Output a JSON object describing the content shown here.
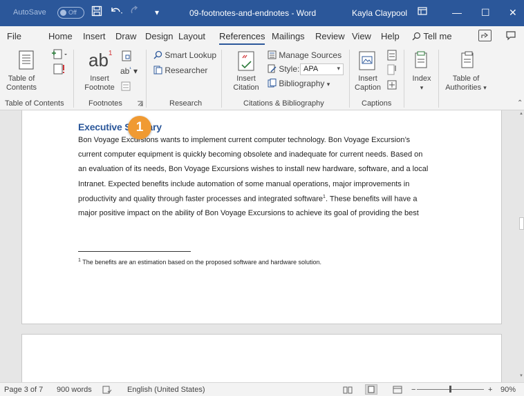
{
  "titlebar": {
    "autosave_label": "AutoSave",
    "autosave_state": "Off",
    "doc_title": "09-footnotes-and-endnotes - Word",
    "user": "Kayla Claypool"
  },
  "tabs": [
    "File",
    "Home",
    "Insert",
    "Draw",
    "Design",
    "Layout",
    "References",
    "Mailings",
    "Review",
    "View",
    "Help"
  ],
  "active_tab": "References",
  "tell_me": "Tell me",
  "ribbon": {
    "toc": {
      "button": "Table of Contents",
      "line1": "Table of",
      "line2": "Contents",
      "group": "Table of Contents"
    },
    "footnotes": {
      "insert_footnote_line1": "Insert",
      "insert_footnote_line2": "Footnote",
      "ab_glyph": "ab",
      "group": "Footnotes"
    },
    "research": {
      "smart_lookup": "Smart Lookup",
      "researcher": "Researcher",
      "group": "Research"
    },
    "citations": {
      "insert_citation_line1": "Insert",
      "insert_citation_line2": "Citation",
      "manage_sources": "Manage Sources",
      "style_label": "Style:",
      "style_value": "APA",
      "bibliography": "Bibliography",
      "group": "Citations & Bibliography"
    },
    "captions": {
      "insert_caption_line1": "Insert",
      "insert_caption_line2": "Caption",
      "group": "Captions"
    },
    "index": {
      "label": "Index"
    },
    "authorities": {
      "line1": "Table of",
      "line2": "Authorities"
    }
  },
  "document": {
    "heading_part1": "Executive S",
    "heading_part2": "ary",
    "lines": [
      "Bon Voyage Excursions wants to implement current computer technology. Bon Voyage Excursion’s",
      "current computer equipment is quickly becoming obsolete and inadequate for current needs. Based on",
      "an evaluation of its needs, Bon Voyage Excursions wishes to install new hardware, software, and a local",
      "Intranet. Expected benefits include automation of some manual operations, major improvements in",
      "productivity and quality through faster processes and integrated software",
      "major positive impact on the ability of Bon Voyage Excursions to achieve its goal of providing the best"
    ],
    "line5_tail": ". These benefits will have a",
    "footnote_ref": "1",
    "footnote_text": "The benefits are an estimation based on the proposed software and hardware solution."
  },
  "callout_number": "1",
  "status": {
    "page": "Page 3 of 7",
    "words": "900 words",
    "language": "English (United States)",
    "zoom": "90%"
  },
  "colors": {
    "word_blue": "#2b579a",
    "callout_orange": "#f09a32"
  }
}
